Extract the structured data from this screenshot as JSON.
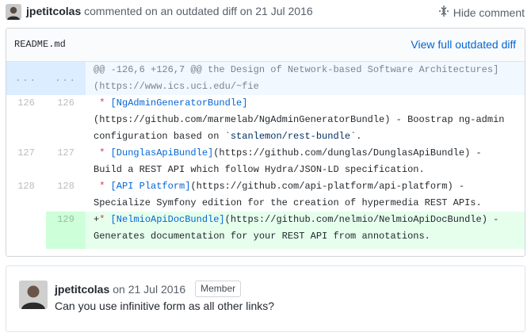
{
  "header": {
    "user": "jpetitcolas",
    "action_text": " commented on an outdated diff on 21 Jul 2016",
    "hide_label": "Hide comment",
    "hide_icon": "fold-icon"
  },
  "file": {
    "name": "README.md",
    "view_full_label": "View full outdated diff",
    "hunk_marker_old": "...",
    "hunk_marker_new": "...",
    "hunk_line1": "@@ -126,6 +126,7 @@ the Design of Network-based Software Architectures]",
    "hunk_line2": "(https://www.ics.uci.edu/~fie",
    "lines": [
      {
        "old": "126",
        "new": "126",
        "star": "*",
        "link_text": "[NgAdminGeneratorBundle]",
        "text1": "",
        "line2": "(https://github.com/marmelab/NgAdminGeneratorBundle) - Boostrap ng-admin",
        "line3_pre": "configuration based on ",
        "line3_str": "`stanlemon/rest-bundle`",
        "line3_post": "."
      },
      {
        "old": "127",
        "new": "127",
        "star": "*",
        "link_text": "[DunglasApiBundle]",
        "text1": "(https://github.com/dunglas/DunglasApiBundle) -",
        "line2": "Build a REST API which follow Hydra/JSON-LD specification."
      },
      {
        "old": "128",
        "new": "128",
        "star": "*",
        "link_text": "[API Platform]",
        "text1": "(https://github.com/api-platform/api-platform) -",
        "line2": "Specialize Symfony edition for the creation of hypermedia REST APIs."
      },
      {
        "old": "",
        "new": "129",
        "sign": "+",
        "star": "*",
        "link_text": "[NelmioApiDocBundle]",
        "text1": "(https://github.com/nelmio/NelmioApiDocBundle) -",
        "line2": "Generates documentation for your REST API from annotations."
      }
    ]
  },
  "comment": {
    "user": "jpetitcolas",
    "date_text": "on 21 Jul 2016",
    "badge": "Member",
    "body": "Can you use infinitive form as all other links?"
  }
}
